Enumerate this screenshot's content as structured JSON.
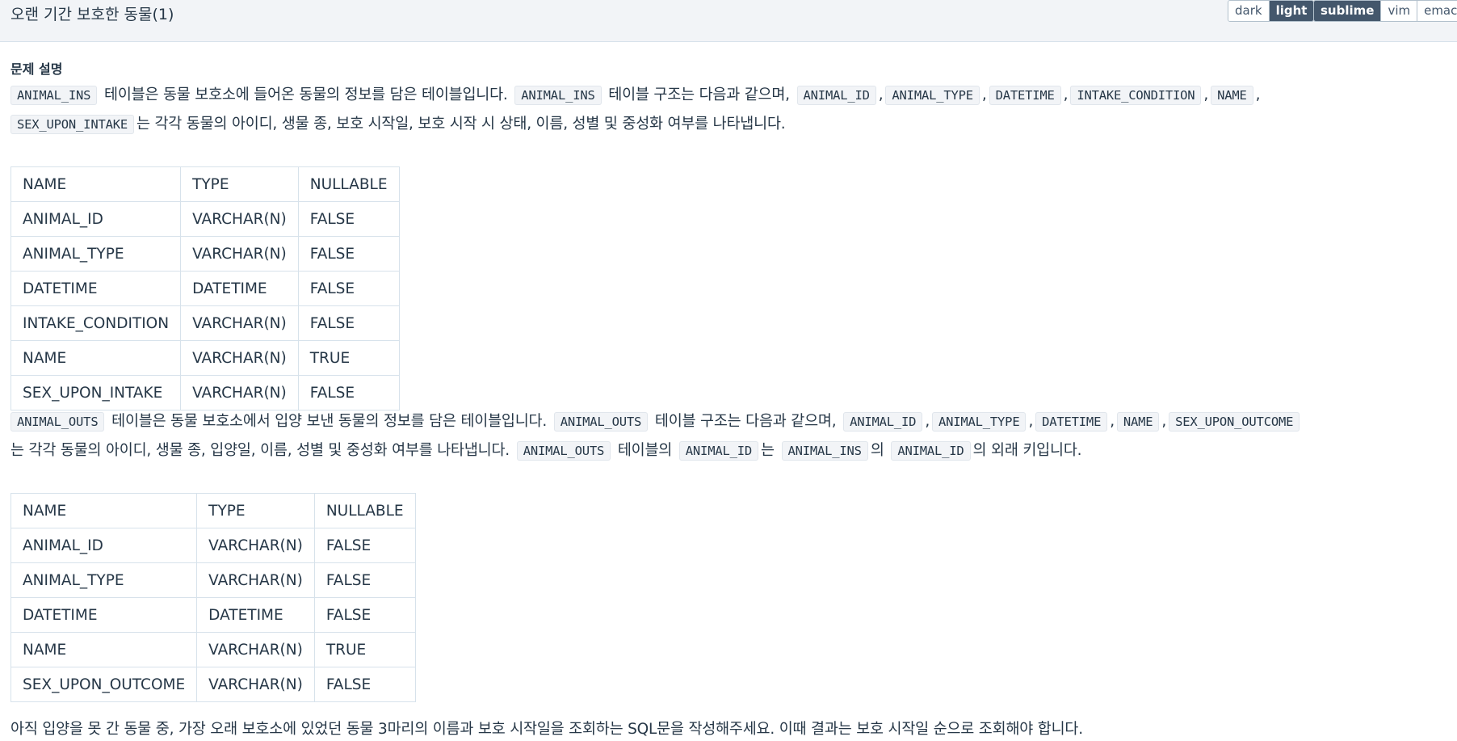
{
  "header": {
    "title": "오랜 기간 보호한 동물(1)",
    "theme_buttons": [
      {
        "label": "dark",
        "active": false
      },
      {
        "label": "light",
        "active": true
      }
    ],
    "keymap_buttons": [
      {
        "label": "sublime",
        "active": true
      },
      {
        "label": "vim",
        "active": false
      },
      {
        "label": "emacs",
        "active": false
      }
    ]
  },
  "problem": {
    "heading": "문제 설명",
    "p1": {
      "code_animal_ins": "ANIMAL_INS",
      "t1": " 테이블은 동물 보호소에 들어온 동물의 정보를 담은 테이블입니다. ",
      "t2": " 테이블 구조는 다음과 같으며, ",
      "cols": [
        "ANIMAL_ID",
        "ANIMAL_TYPE",
        "DATETIME",
        "INTAKE_CONDITION",
        "NAME",
        "SEX_UPON_INTAKE"
      ],
      "sep": ",",
      "t3": "는 각각 동물의 아이디, 생물 종, 보호 시작일, 보호 시작 시 상태, 이름, 성별 및 중성화 여부를 나타냅니다."
    },
    "table1": {
      "headers": [
        "NAME",
        "TYPE",
        "NULLABLE"
      ],
      "rows": [
        [
          "ANIMAL_ID",
          "VARCHAR(N)",
          "FALSE"
        ],
        [
          "ANIMAL_TYPE",
          "VARCHAR(N)",
          "FALSE"
        ],
        [
          "DATETIME",
          "DATETIME",
          "FALSE"
        ],
        [
          "INTAKE_CONDITION",
          "VARCHAR(N)",
          "FALSE"
        ],
        [
          "NAME",
          "VARCHAR(N)",
          "TRUE"
        ],
        [
          "SEX_UPON_INTAKE",
          "VARCHAR(N)",
          "FALSE"
        ]
      ]
    },
    "p2": {
      "code_animal_outs": "ANIMAL_OUTS",
      "t1": " 테이블은 동물 보호소에서 입양 보낸 동물의 정보를 담은 테이블입니다. ",
      "t2": " 테이블 구조는 다음과 같으며, ",
      "cols": [
        "ANIMAL_ID",
        "ANIMAL_TYPE",
        "DATETIME",
        "NAME",
        "SEX_UPON_OUTCOME"
      ],
      "sep": ",",
      "t3": "는 각각 동물의 아이디, 생물 종, 입양일, 이름, 성별 및 중성화 여부를 나타냅니다. ",
      "t4": " 테이블의 ",
      "code_animal_id": "ANIMAL_ID",
      "t5": "는 ",
      "code_animal_ins": "ANIMAL_INS",
      "t6": "의 ",
      "t7": "의 외래 키입니다."
    },
    "table2": {
      "headers": [
        "NAME",
        "TYPE",
        "NULLABLE"
      ],
      "rows": [
        [
          "ANIMAL_ID",
          "VARCHAR(N)",
          "FALSE"
        ],
        [
          "ANIMAL_TYPE",
          "VARCHAR(N)",
          "FALSE"
        ],
        [
          "DATETIME",
          "DATETIME",
          "FALSE"
        ],
        [
          "NAME",
          "VARCHAR(N)",
          "TRUE"
        ],
        [
          "SEX_UPON_OUTCOME",
          "VARCHAR(N)",
          "FALSE"
        ]
      ]
    },
    "final": "아직 입양을 못 간 동물 중, 가장 오래 보호소에 있었던 동물 3마리의 이름과 보호 시작일을 조회하는 SQL문을 작성해주세요. 이때 결과는 보호 시작일 순으로 조회해야 합니다."
  }
}
